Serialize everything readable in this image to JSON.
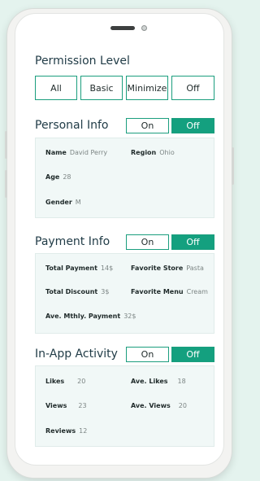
{
  "permission": {
    "title": "Permission Level",
    "options": [
      "All",
      "Basic",
      "Minimize",
      "Off"
    ]
  },
  "personal": {
    "title": "Personal Info",
    "on_label": "On",
    "off_label": "Off",
    "fields": {
      "name": {
        "k": "Name",
        "v": "David Perry"
      },
      "region": {
        "k": "Region",
        "v": "Ohio"
      },
      "age": {
        "k": "Age",
        "v": "28"
      },
      "gender": {
        "k": "Gender",
        "v": "M"
      }
    }
  },
  "payment": {
    "title": "Payment Info",
    "on_label": "On",
    "off_label": "Off",
    "fields": {
      "total_payment": {
        "k": "Total Payment",
        "v": "14$"
      },
      "favorite_store": {
        "k": "Favorite Store",
        "v": "Pasta"
      },
      "total_discount": {
        "k": "Total Discount",
        "v": "3$"
      },
      "favorite_menu": {
        "k": "Favorite Menu",
        "v": "Cream"
      },
      "ave_mthly_payment": {
        "k": "Ave. Mthly. Payment",
        "v": "32$"
      }
    }
  },
  "activity": {
    "title": "In-App Activity",
    "on_label": "On",
    "off_label": "Off",
    "fields": {
      "likes": {
        "k": "Likes",
        "v": "20"
      },
      "ave_likes": {
        "k": "Ave. Likes",
        "v": "18"
      },
      "views": {
        "k": "Views",
        "v": "23"
      },
      "ave_views": {
        "k": "Ave. Views",
        "v": "20"
      },
      "reviews": {
        "k": "Reviews",
        "v": "12"
      }
    }
  },
  "colors": {
    "accent": "#14a07f",
    "page_bg": "#e4f3ee",
    "panel_bg": "#f1f8f7"
  }
}
